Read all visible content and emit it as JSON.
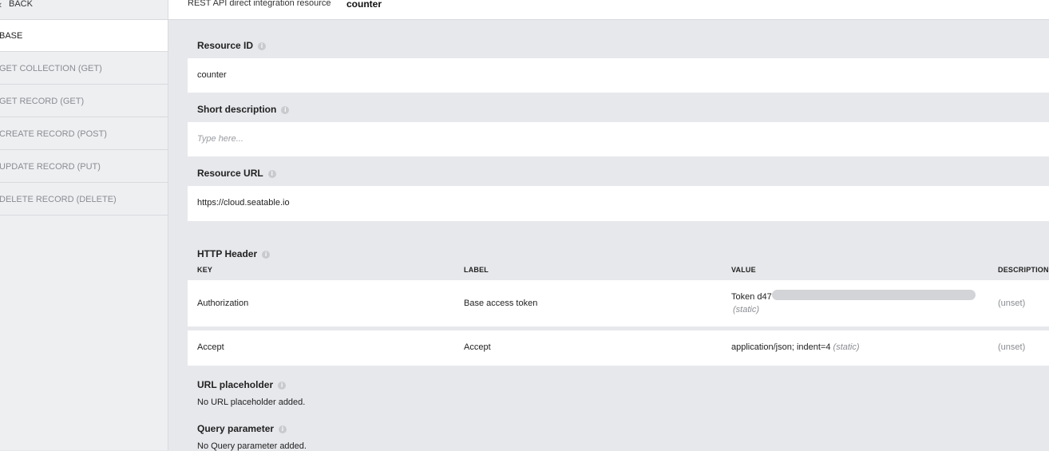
{
  "sidebar": {
    "back_label": "BACK",
    "items": [
      {
        "label": "BASE",
        "active": true
      },
      {
        "label": "GET COLLECTION (GET)"
      },
      {
        "label": "GET RECORD (GET)"
      },
      {
        "label": "CREATE RECORD (POST)"
      },
      {
        "label": "UPDATE RECORD (PUT)"
      },
      {
        "label": "DELETE RECORD (DELETE)"
      }
    ]
  },
  "header": {
    "title_prefix": "REST API direct integration resource",
    "resource_name": "counter"
  },
  "fields": {
    "resource_id": {
      "label": "Resource ID",
      "value": "counter"
    },
    "short_description": {
      "label": "Short description",
      "placeholder": "Type here..."
    },
    "resource_url": {
      "label": "Resource URL",
      "value": "https://cloud.seatable.io"
    }
  },
  "http_header": {
    "label": "HTTP Header",
    "columns": [
      "KEY",
      "LABEL",
      "VALUE",
      "DESCRIPTION"
    ],
    "rows": [
      {
        "key": "Authorization",
        "label": "Base access token",
        "value": "Token d47",
        "value_note": "(static)",
        "description": "(unset)"
      },
      {
        "key": "Accept",
        "label": "Accept",
        "value": "application/json; indent=4",
        "value_note": "(static)",
        "description": "(unset)"
      }
    ]
  },
  "url_placeholder": {
    "label": "URL placeholder",
    "empty_text": "No URL placeholder added."
  },
  "query_parameter": {
    "label": "Query parameter",
    "empty_text": "No Query parameter added."
  },
  "icons": {
    "back": "chevron-left-icon",
    "info": "info-icon"
  }
}
